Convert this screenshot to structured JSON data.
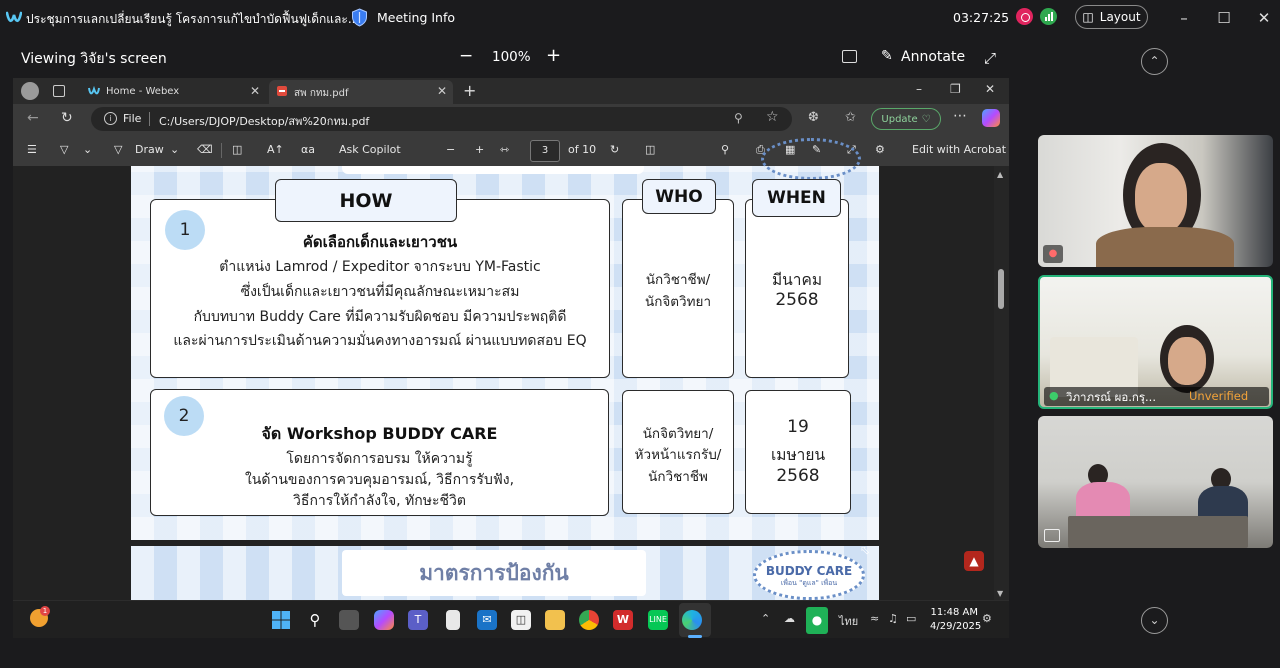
{
  "webex": {
    "meeting_title": "ประชุมการแลกเปลี่ยนเรียนรู้ โครงการแก้ไขบำบัดฟื้นฟูเด็กและ...",
    "meeting_info": "Meeting Info",
    "timer": "03:27:25",
    "layout_label": "Layout",
    "viewing_label": "Viewing วิจัย's screen",
    "zoom": "100%",
    "annotate_label": "Annotate"
  },
  "browser": {
    "tabs": [
      {
        "label": "Home - Webex"
      },
      {
        "label": "สพ กทม.pdf"
      }
    ],
    "file_label": "File",
    "url": "C:/Users/DJOP/Desktop/สพ%20กทม.pdf",
    "update_label": "Update",
    "pdf_toolbar": {
      "draw": "Draw",
      "ask_copilot": "Ask Copilot",
      "page_current": "3",
      "page_total": "of 10",
      "edit_acrobat": "Edit with Acrobat"
    }
  },
  "slide": {
    "headers": {
      "how": "HOW",
      "who": "WHO",
      "when": "WHEN"
    },
    "rows": [
      {
        "num": "1",
        "title": "คัดเลือกเด็กและเยาวชน",
        "lines": [
          "ตำแหน่ง Lamrod / Expeditor จากระบบ YM-Fastic",
          "ซึ่งเป็นเด็กและเยาวชนที่มีคุณลักษณะเหมาะสม",
          "กับบทบาท Buddy Care ที่มีความรับผิดชอบ มีความประพฤติดี",
          "และผ่านการประเมินด้านความมั่นคงทางอารมณ์ ผ่านแบบทดสอบ EQ"
        ],
        "who": [
          "นักวิชาชีพ/",
          "นักจิตวิทยา"
        ],
        "when": [
          "มีนาคม",
          "2568"
        ]
      },
      {
        "num": "2",
        "title": "จัด Workshop BUDDY CARE",
        "lines": [
          "โดยการจัดการอบรม ให้ความรู้",
          "ในด้านของการควบคุมอารมณ์, วิธีการรับฟัง,",
          "วิธีการให้กำลังใจ, ทักษะชีวิต"
        ],
        "who": [
          "นักจิตวิทยา/",
          "หัวหน้าแรกรับ/",
          "นักวิชาชีพ"
        ],
        "when": [
          "19",
          "เมษายน",
          "2568"
        ]
      }
    ],
    "next_page_title": "มาตรการป้องกัน",
    "buddy_logo": {
      "title": "BUDDY CARE",
      "subtitle": "เพื่อน \"ดูแล\" เพื่อน"
    }
  },
  "taskbar": {
    "weather_badge": "1",
    "lang": "ไทย",
    "time": "11:48 AM",
    "date": "4/29/2025"
  },
  "participants": [
    {
      "name": "",
      "muted": true
    },
    {
      "name": "วิภาภรณ์  ผอ.กรุ...",
      "status": "Unverified",
      "active_speaker": true
    },
    {
      "name": "",
      "sharing": true
    }
  ],
  "colors": {
    "accent_green": "#25b47a",
    "record_red": "#e0245e",
    "slide_bg": "#cfe0f4",
    "slide_number_bg": "#bcdcf5"
  }
}
